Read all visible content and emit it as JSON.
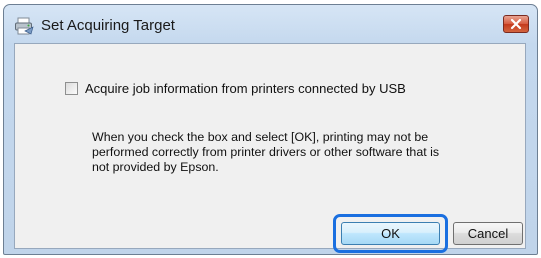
{
  "window": {
    "title": "Set Acquiring Target",
    "app_icon": "printer-icon",
    "close_icon": "close-icon"
  },
  "checkbox": {
    "label": "Acquire job information from printers connected by USB",
    "checked": false
  },
  "note": {
    "line1": "When you check the box and select [OK], printing may not be",
    "line2": "performed correctly from printer drivers or other software that is",
    "line3": "not provided by Epson."
  },
  "buttons": {
    "ok_label": "OK",
    "cancel_label": "Cancel"
  },
  "colors": {
    "highlight": "#1a6fe0",
    "close_button": "#c4391c"
  }
}
